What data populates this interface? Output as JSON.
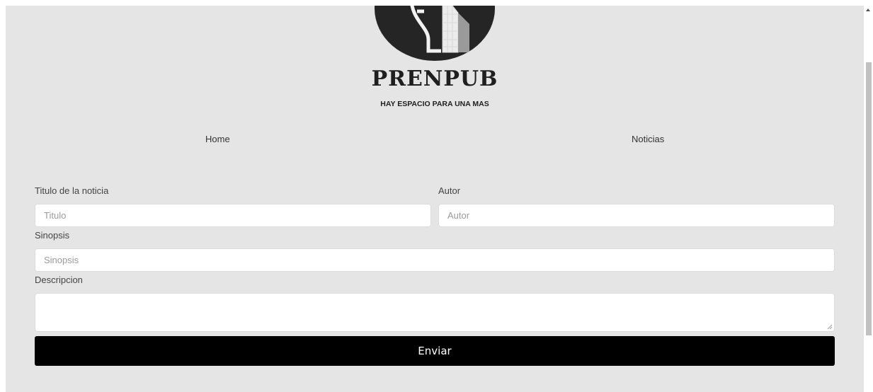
{
  "brand": {
    "name": "PRENPUB",
    "tagline": "HAY ESPACIO PARA UNA MAS"
  },
  "nav": {
    "home": "Home",
    "noticias": "Noticias"
  },
  "form": {
    "titulo": {
      "label": "Titulo de la noticia",
      "placeholder": "Titulo",
      "value": ""
    },
    "autor": {
      "label": "Autor",
      "placeholder": "Autor",
      "value": ""
    },
    "sinopsis": {
      "label": "Sinopsis",
      "placeholder": "Sinopsis",
      "value": ""
    },
    "descripcion": {
      "label": "Descripcion",
      "value": ""
    },
    "submit_label": "Enviar"
  },
  "icons": {
    "logo": "logo-icon",
    "resize": "resize-grip-icon",
    "scroll_up": "chevron-up-icon"
  },
  "colors": {
    "page_bg": "#e5e5e5",
    "logo_bg": "#252525",
    "button_bg": "#000000",
    "button_text": "#ffffff"
  }
}
